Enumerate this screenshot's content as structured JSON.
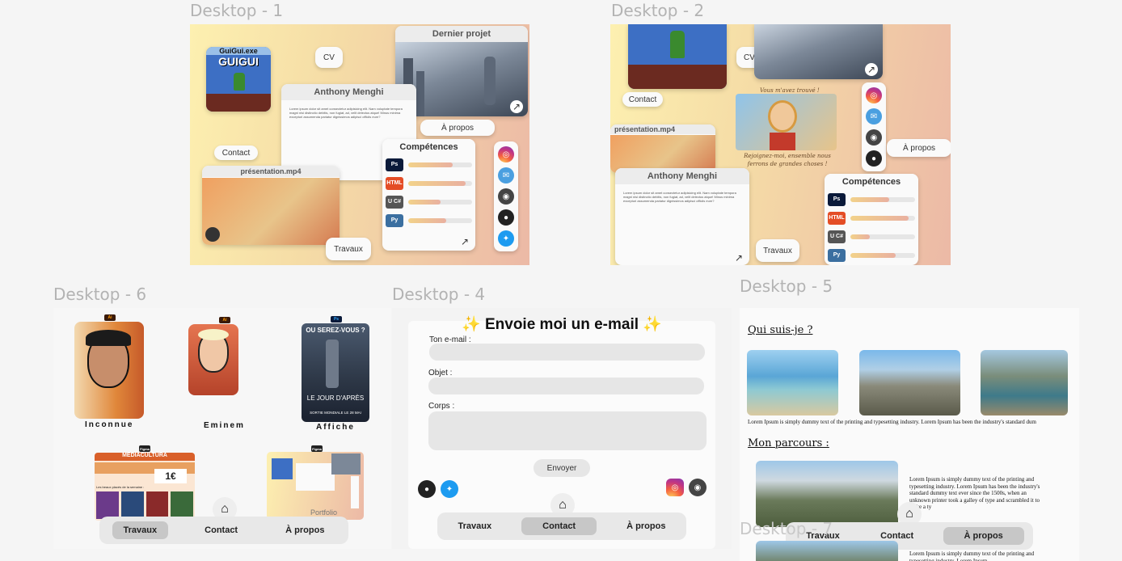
{
  "frames": {
    "d1": "Desktop - 1",
    "d2": "Desktop - 2",
    "d6": "Desktop - 6",
    "d4": "Desktop - 4",
    "d5": "Desktop - 5",
    "d7": "Desktop - 7"
  },
  "desktop1": {
    "game_title": "GuiGui.exe",
    "game_logo": "GUIGUI",
    "cv": "CV",
    "last_project": "Dernier projet",
    "name": "Anthony Menghi",
    "bio": "Lorem ipsum dolor sit amet consectetur adipisicing elit. Nam voluptate tempora magni nisi distinctio debitis, non fugiat, ad, velit delectus atque! Minus minima excepturi assumenda pariatur dignissimos adipisci officiis eum?",
    "about": "À propos",
    "skills": "Compétences",
    "contact": "Contact",
    "presentation": "présentation.mp4",
    "works": "Travaux"
  },
  "desktop2": {
    "cv": "CV",
    "contact": "Contact",
    "presentation": "présentation.mp4",
    "name": "Anthony Menghi",
    "bio": "Lorem ipsum dolor sit amet consectetur adipisicing elit. Nam voluptate tempora magni nisi distinctio debitis, non fugiat, ad, velit delectus atque! Minus minima excepturi assumenda pariatur dignissimos adipisci officiis eum?",
    "works": "Travaux",
    "skills": "Compétences",
    "about": "À propos",
    "caption_top": "Vous m'avez trouvé !",
    "caption_bottom": "Rejoignez-moi, ensemble nous ferrons de grandes choses !"
  },
  "desktop6": {
    "items": [
      {
        "label": "Inconnue",
        "tag": "Ai"
      },
      {
        "label": "Eminem",
        "tag": "Ai"
      },
      {
        "label": "Affiche",
        "tag": "Ps"
      }
    ],
    "poster_top": "OU SEREZ-VOUS ?",
    "poster_logo": "GUIGUI",
    "poster_title": "LE JOUR D'APRÈS",
    "poster_date": "SORTIE MONDIALE LE 28 MAI",
    "site1_title": "MEDIACULTURA",
    "site1_price": "1€",
    "site1_caption": "Les beaux placés de la semaine :",
    "site2_label": "Portfolio",
    "figma_tag": "Figma",
    "nav": [
      "Travaux",
      "Contact",
      "À propos"
    ]
  },
  "desktop4": {
    "title": "✨ Envoie moi un e-mail ✨",
    "email_label": "Ton e-mail :",
    "subject_label": "Objet :",
    "body_label": "Corps :",
    "send": "Envoyer",
    "nav": [
      "Travaux",
      "Contact",
      "À propos"
    ]
  },
  "desktop5": {
    "who": "Qui suis-je ?",
    "lorem_line": "Lorem Ipsum is simply dummy text of the printing and typesetting industry. Lorem Ipsum has been the industry's standard dum",
    "path": "Mon parcours :",
    "path_text": "Lorem Ipsum is simply dummy text of the printing and typesetting industry. Lorem Ipsum has been the industry's standard dummy text ever since the 1500s, when an unknown printer took a galley of type and scrambled it to make a ty",
    "path_text2": "Lorem Ipsum is simply dummy text of the printing and typesetting industry. Lorem Ipsum",
    "nav": [
      "Travaux",
      "Contact",
      "À propos"
    ]
  },
  "skill_levels": [
    0.7,
    0.9,
    0.5,
    0.6
  ],
  "skill_levels2": [
    0.6,
    0.9,
    0.3,
    0.7
  ],
  "colors": {
    "bg": "#f5f5f5",
    "accent": "#ecb9a6"
  }
}
